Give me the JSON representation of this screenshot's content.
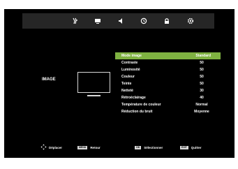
{
  "tabs": [
    {
      "icon": "picture-tab-icon",
      "active": true
    },
    {
      "icon": "display-tab-icon",
      "active": false
    },
    {
      "icon": "audio-tab-icon",
      "active": false
    },
    {
      "icon": "timer-tab-icon",
      "active": false
    },
    {
      "icon": "lock-tab-icon",
      "active": false
    },
    {
      "icon": "settings-tab-icon",
      "active": false
    }
  ],
  "section": {
    "label": "IMAGE"
  },
  "menu": [
    {
      "label": "Mode image",
      "value": "Standard",
      "selected": true
    },
    {
      "label": "Contraste",
      "value": "50"
    },
    {
      "label": "Luminosité",
      "value": "50"
    },
    {
      "label": "Couleur",
      "value": "50"
    },
    {
      "label": "Teinte",
      "value": "50"
    },
    {
      "label": "Netteté",
      "value": "30"
    },
    {
      "label": "Rétroéclairage",
      "value": "40"
    },
    {
      "label": "Température de couleur",
      "value": "Normal"
    },
    {
      "label": "Réduction du bruit",
      "value": "Moyenne"
    }
  ],
  "footer": {
    "move": "Déplacer",
    "menu_key": "MENU",
    "back": "Retour",
    "ok_key": "OK",
    "select": "Sélectionner",
    "exit_key": "EXIT",
    "exit": "Quitter"
  },
  "colors": {
    "highlight": "#7fb241",
    "background": "#000000",
    "tabbar": "#262626"
  }
}
